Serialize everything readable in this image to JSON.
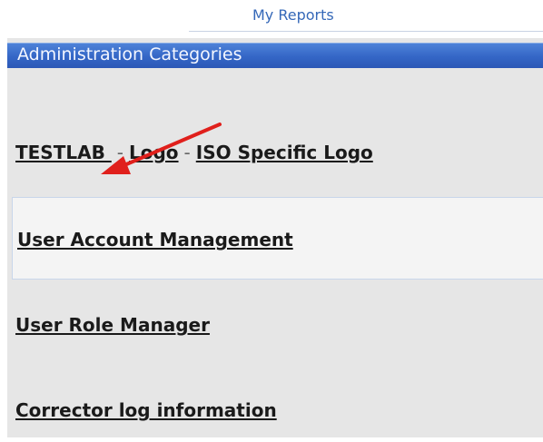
{
  "tab": {
    "label": "My Reports"
  },
  "panel": {
    "header": "Administration Categories",
    "links": {
      "testlab": "TESTLAB ",
      "separator": "-",
      "logo": "Logo",
      "iso_logo": "ISO Specific Logo",
      "user_account_management": "User Account Management",
      "user_role_manager": "User Role Manager",
      "corrector_log": "Corrector log information"
    }
  },
  "colors": {
    "tab_text": "#3568b8",
    "header_bg": "#3466c6",
    "panel_bg": "#e6e6e6",
    "arrow": "#e0201c"
  }
}
